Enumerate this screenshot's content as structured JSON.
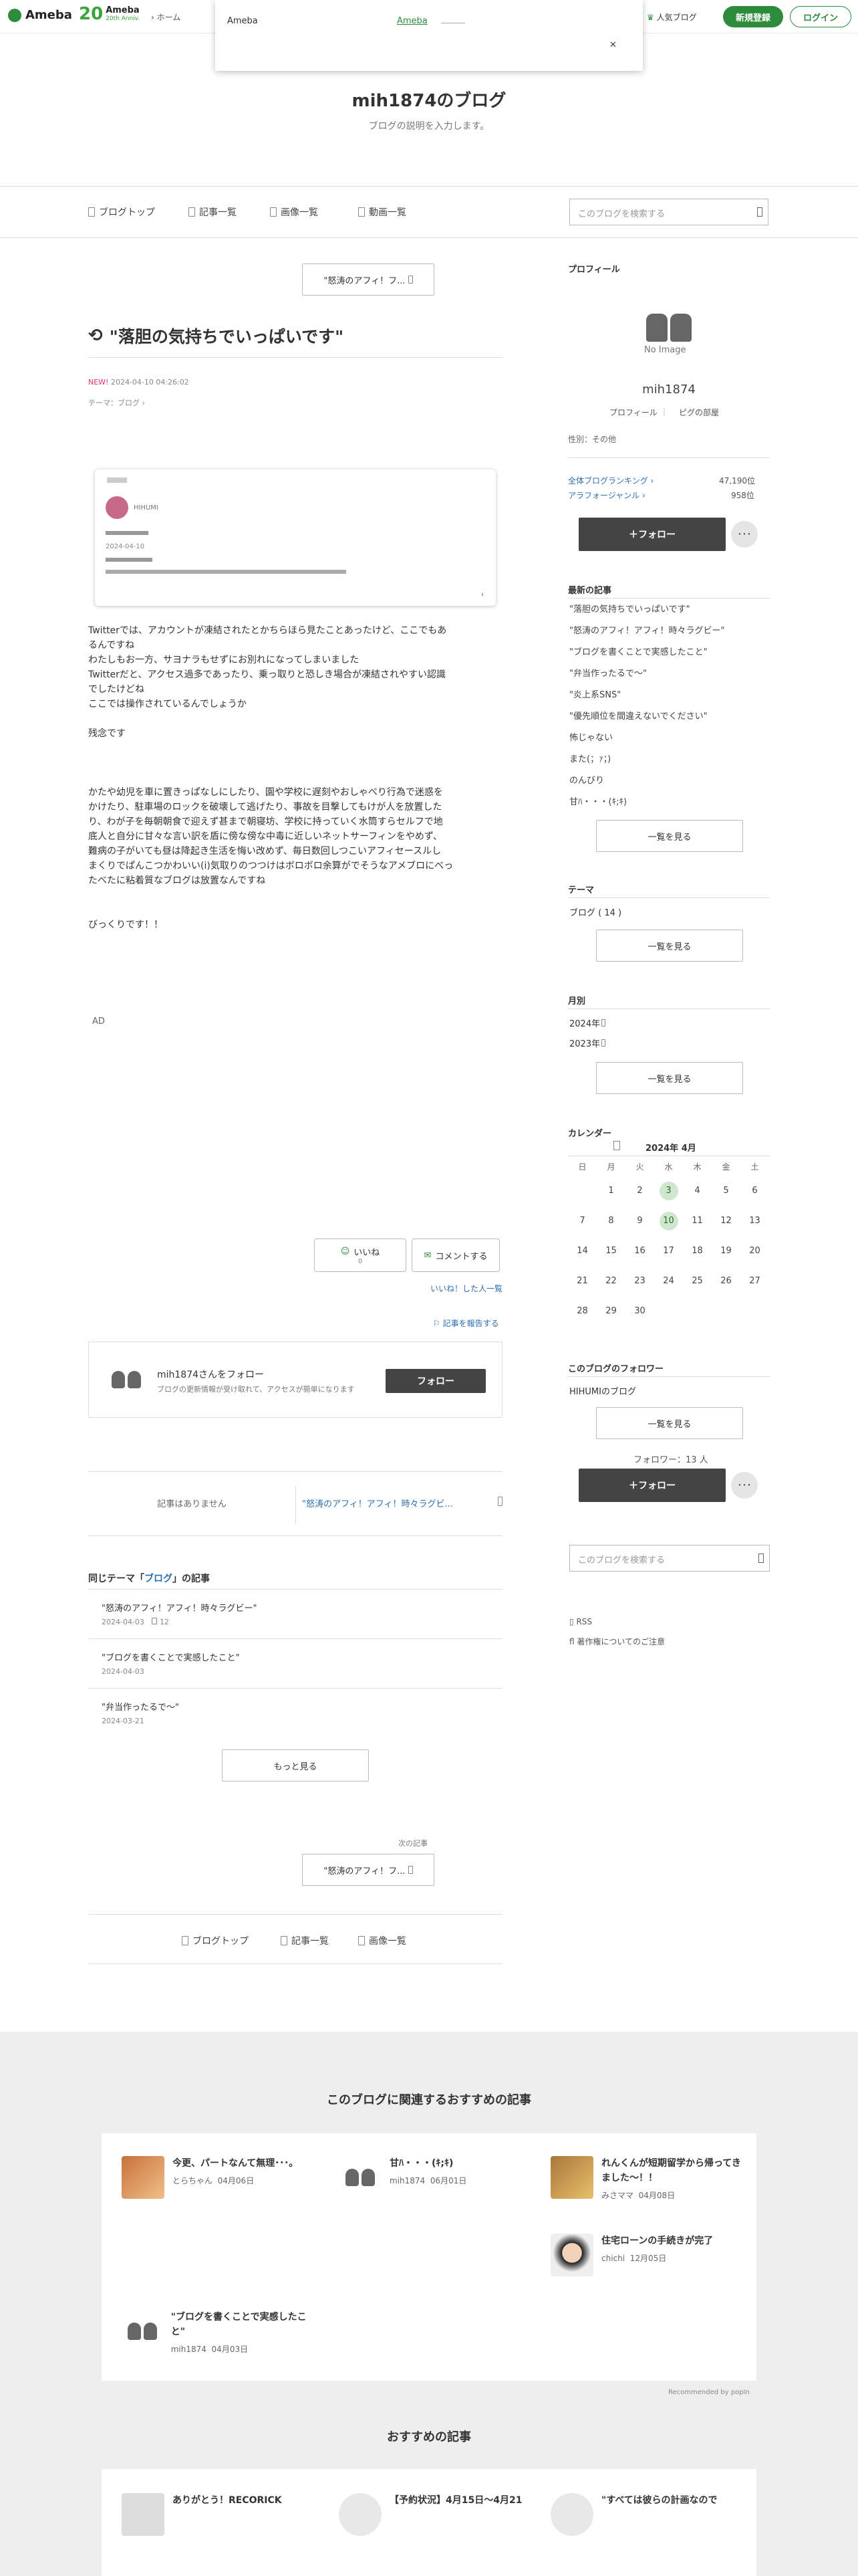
{
  "header": {
    "ameba": "Ameba",
    "anniv_num": "20",
    "anniv_title": "Ameba",
    "anniv_sub": "20th Anniv.",
    "home": "ホーム",
    "popular": "人気ブログ",
    "signup": "新規登録",
    "login": "ログイン"
  },
  "popup": {
    "left": "Ameba",
    "link": "Ameba",
    "close": "✕"
  },
  "blog": {
    "title": "mih1874のブログ",
    "desc": "ブログの説明を入力します。"
  },
  "nav": {
    "top": "ブログトップ",
    "list": "記事一覧",
    "images": "画像一覧",
    "videos": "動画一覧",
    "search_placeholder": "このブログを検索する"
  },
  "article": {
    "prev_btn": "\"怒涛のアフィ！フ...",
    "title": "\"落胆の気持ちでいっぱいです\"",
    "new": "NEW!",
    "date": "2024-04-10 04:26:02",
    "theme": "テーマ：ブログ",
    "embed_name": "HIHUMI",
    "embed_date": "2024-04-10",
    "para1": [
      "Twitterでは、アカウントが凍結されたとかちらほら見たことあったけど、ここでもあ",
      "るんですね",
      "わたしもお一方、サヨナラもせずにお別れになってしまいました",
      "Twitterだと、アクセス過多であったり、乗っ取りと恐しき場合が凍結されやすい認識",
      "でしたけどね",
      "ここでは操作されているんでしょうか"
    ],
    "para2": "残念です",
    "para3": [
      "かたや幼児を車に置きっぱなしにしたり、園や学校に遅刻やおしゃべり行為で迷惑を",
      "かけたり、駐車場のロックを破壊して逃げたり、事故を目撃してもけが人を放置した",
      "り、わが子を毎朝朝食で迎えず甚まで朝寝坊、学校に持っていく水筒すらセルフで地",
      "底人と自分に甘々な言い訳を盾に傍な傍な中毒に近しいネットサーフィンをやめず、",
      "難病の子がいても昼は降起き生活を悔い改めず、毎日数回しつこいアフィセースルし",
      "まくりでぱんこつかわいい(i)気取りのつつけはボロボロ余算がでそうなアメブロにべっ",
      "たべたに粘着質なブログは放置なんですね"
    ],
    "para4": "びっくりです！！",
    "ad": "AD",
    "like": "いいね",
    "like_count": "0",
    "comment": "コメントする",
    "likers": "いいね！した人一覧",
    "report": "記事を報告する",
    "follow_card_title": "mih1874さんをフォロー",
    "follow_card_desc": "ブログの更新情報が受け取れて、アクセスが簡単になります",
    "follow_btn": "フォロー",
    "no_article": "記事はありません",
    "next_link": "\"怒涛のアフィ！アフィ！時々ラグビ...",
    "same_theme_pre": "同じテーマ「",
    "same_theme_link": "ブログ",
    "same_theme_post": "」の記事",
    "related": [
      {
        "title": "\"怒涛のアフィ！アフィ！時々ラグビー\"",
        "date": "2024-04-03",
        "extra": "12"
      },
      {
        "title": "\"ブログを書くことで実感したこと\"",
        "date": "2024-04-03",
        "extra": ""
      },
      {
        "title": "\"弁当作ったるで〜\"",
        "date": "2024-03-21",
        "extra": ""
      }
    ],
    "more": "もっと見る",
    "next_label": "次の記事",
    "next_btn": "\"怒涛のアフィ！フ...",
    "foot_top": "ブログトップ",
    "foot_list": "記事一覧",
    "foot_images": "画像一覧"
  },
  "sidebar": {
    "profile": "プロフィール",
    "noimage": "No Image",
    "name": "mih1874",
    "prof_link": "プロフィール",
    "pigroom": "ピグの部屋",
    "gender": "性別：その他",
    "rank_all": "全体ブログランキング",
    "rank_all_val": "47,190位",
    "rank_genre": "アラフォージャンル",
    "rank_genre_val": "958位",
    "follow": "＋フォロー",
    "more": "･･･",
    "recent_head": "最新の記事",
    "recent": [
      "\"落胆の気持ちでいっぱいです\"",
      "\"怒涛のアフィ！アフィ！時々ラグビー\"",
      "\"ブログを書くことで実感したこと\"",
      "\"弁当作ったるで〜\"",
      "\"炎上系SNS\"",
      "\"優先順位を間違えないでください\"",
      "怖じゃない",
      "また(；ｧ；)",
      "のんびり",
      "甘ﾊ・・・(ｷ;ｷ)"
    ],
    "list_all": "一覧を見る",
    "theme_head": "テーマ",
    "theme_item": "ブログ ( 14 )",
    "month_head": "月別",
    "months": [
      "2024年",
      "2023年"
    ],
    "cal_head": "カレンダー",
    "cal_title": "2024年 4月",
    "weekdays": [
      "日",
      "月",
      "火",
      "水",
      "木",
      "金",
      "土"
    ],
    "cal_rows": [
      [
        "",
        "1",
        "2",
        "3",
        "4",
        "5",
        "6"
      ],
      [
        "7",
        "8",
        "9",
        "10",
        "11",
        "12",
        "13"
      ],
      [
        "14",
        "15",
        "16",
        "17",
        "18",
        "19",
        "20"
      ],
      [
        "21",
        "22",
        "23",
        "24",
        "25",
        "26",
        "27"
      ],
      [
        "28",
        "29",
        "30",
        "",
        "",
        "",
        ""
      ]
    ],
    "cal_marked": [
      "3",
      "10"
    ],
    "followers_head": "このブログのフォロワー",
    "follower": "HIHUMIのブログ",
    "follower_count": "フォロワー：13 人",
    "search_placeholder": "このブログを検索する",
    "rss": "RSS",
    "copyright": "著作権についてのご注意"
  },
  "recs": {
    "head": "このブログに関連するおすすめの記事",
    "items": [
      {
        "title": "今更、パートなんて無理･･･。",
        "author": "とらちゃん",
        "date": "04月06日"
      },
      {
        "title": "甘ﾊ・・・(ｷ;ｷ)",
        "author": "mih1874",
        "date": "06月01日"
      },
      {
        "title": "れんくんが短期留学から帰ってきました〜！！",
        "author": "みさママ",
        "date": "04月08日"
      },
      {
        "title": "住宅ローンの手続きが完了",
        "author": "chichi",
        "date": "12月05日"
      },
      {
        "title": "\"ブログを書くことで実感したこと\"",
        "author": "mih1874",
        "date": "04月03日"
      }
    ],
    "recommended_by": "Recommended by",
    "powered": "popIn",
    "head2": "おすすめの記事",
    "items2": [
      {
        "title": "ありがとう！RECORICK"
      },
      {
        "title": "【予約状況】4月15日〜4月21"
      },
      {
        "title": "\"すべては彼らの計画なので"
      }
    ]
  },
  "colors": {
    "green": "#2d8c3c",
    "link": "#2e6fb0",
    "new": "#e0307a",
    "dark": "#444444"
  }
}
